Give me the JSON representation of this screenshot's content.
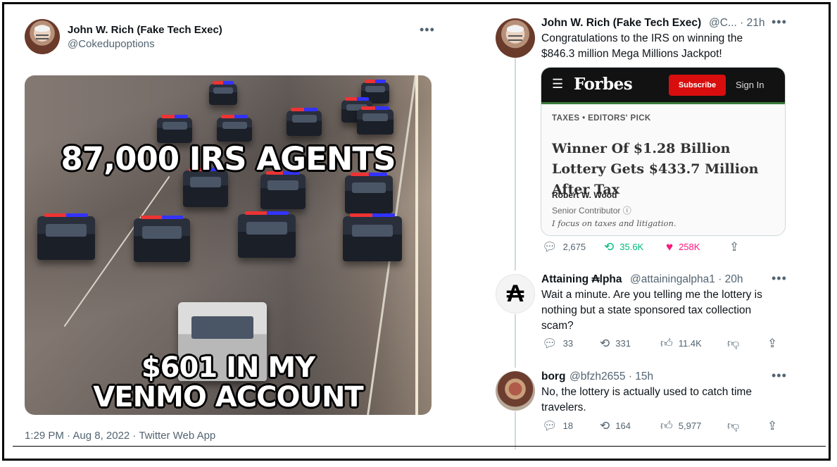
{
  "main_tweet": {
    "display_name": "John W. Rich (Fake Tech Exec)",
    "handle": "@Cokedupoptions",
    "more_icon": "more-horizontal-icon",
    "meme": {
      "top_text": "87,000 IRS AGENTS",
      "bottom_line1": "$601 IN MY",
      "bottom_line2": "VENMO ACCOUNT"
    },
    "meta": "1:29 PM · Aug 8, 2022 · Twitter Web App"
  },
  "thread": {
    "tweet": {
      "display_name": "John W. Rich (Fake Tech Exec)",
      "handle_time": "@C... · 21h",
      "text_line1": "Congratulations to the IRS on winning the",
      "text_line2": "$846.3 million Mega Millions Jackpot!",
      "card": {
        "logo": "Forbes",
        "subscribe": "Subscribe",
        "sign_in": "Sign In",
        "kicker": "TAXES • EDITORS' PICK",
        "headline": "Winner Of $1.28 Billion Lottery Gets $433.7 Million After Tax",
        "author": "Robert W. Wood",
        "role": "Senior Contributor ⓘ",
        "bio": "I focus on taxes and litigation."
      },
      "replies": "2,675",
      "retweets": "35.6K",
      "likes": "258K"
    },
    "reply1": {
      "display_name": "Attaining ₳lpha",
      "handle_time": "@attainingalpha1 · 20h",
      "text_line1": "Wait a minute.  Are you telling me the lottery is",
      "text_line2": "nothing but a state sponsored tax collection",
      "text_line3": "scam?",
      "replies": "33",
      "retweets": "331",
      "likes": "11.4K",
      "avatar_glyph": "₳"
    },
    "reply2": {
      "display_name": "borg",
      "handle_time": "@bfzh2655 · 15h",
      "text_line1": "No, the lottery is actually used to catch time",
      "text_line2": "travelers.",
      "replies": "18",
      "retweets": "164",
      "likes": "5,977"
    }
  },
  "colors": {
    "text": "#0f1419",
    "muted": "#536471",
    "retweet": "#00ba7c",
    "like": "#f91880",
    "forbes_red": "#d80e0e"
  }
}
